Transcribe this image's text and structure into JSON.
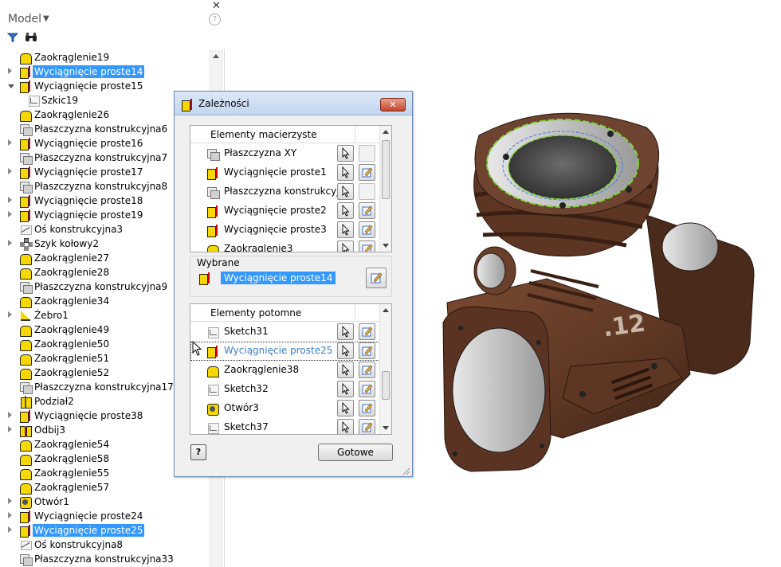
{
  "browser": {
    "title": "Model",
    "close": "✕",
    "help": "?",
    "tree": [
      {
        "label": "Zaokrąglenie19",
        "icon": "fillet",
        "expander": "none",
        "selected": false
      },
      {
        "label": "Wyciągnięcie proste14",
        "icon": "extrude",
        "expander": "closed",
        "selected": true
      },
      {
        "label": "Wyciągnięcie proste15",
        "icon": "extrude",
        "expander": "open",
        "selected": false
      },
      {
        "label": "Szkic19",
        "icon": "sketch",
        "expander": "none",
        "indent": true,
        "selected": false
      },
      {
        "label": "Zaokrąglenie26",
        "icon": "fillet",
        "expander": "none",
        "selected": false
      },
      {
        "label": "Płaszczyzna konstrukcyjna6",
        "icon": "plane",
        "expander": "none",
        "selected": false
      },
      {
        "label": "Wyciągnięcie proste16",
        "icon": "extrude",
        "expander": "closed",
        "selected": false
      },
      {
        "label": "Płaszczyzna konstrukcyjna7",
        "icon": "plane",
        "expander": "none",
        "selected": false
      },
      {
        "label": "Wyciągnięcie proste17",
        "icon": "extrude",
        "expander": "closed",
        "selected": false
      },
      {
        "label": "Płaszczyzna konstrukcyjna8",
        "icon": "plane",
        "expander": "none",
        "selected": false
      },
      {
        "label": "Wyciągnięcie proste18",
        "icon": "extrude",
        "expander": "closed",
        "selected": false
      },
      {
        "label": "Wyciągnięcie proste19",
        "icon": "extrude",
        "expander": "closed",
        "selected": false
      },
      {
        "label": "Oś konstrukcyjna3",
        "icon": "axis",
        "expander": "none",
        "selected": false
      },
      {
        "label": "Szyk kołowy2",
        "icon": "pattern",
        "expander": "closed",
        "selected": false
      },
      {
        "label": "Zaokrąglenie27",
        "icon": "fillet",
        "expander": "none",
        "selected": false
      },
      {
        "label": "Zaokrąglenie28",
        "icon": "fillet",
        "expander": "none",
        "selected": false
      },
      {
        "label": "Płaszczyzna konstrukcyjna9",
        "icon": "plane",
        "expander": "none",
        "selected": false
      },
      {
        "label": "Zaokrąglenie34",
        "icon": "fillet",
        "expander": "none",
        "selected": false
      },
      {
        "label": "Żebro1",
        "icon": "rib",
        "expander": "closed",
        "selected": false
      },
      {
        "label": "Zaokrąglenie49",
        "icon": "fillet",
        "expander": "none",
        "selected": false
      },
      {
        "label": "Zaokrąglenie50",
        "icon": "fillet",
        "expander": "none",
        "selected": false
      },
      {
        "label": "Zaokrąglenie51",
        "icon": "fillet",
        "expander": "none",
        "selected": false
      },
      {
        "label": "Zaokrąglenie52",
        "icon": "fillet",
        "expander": "none",
        "selected": false
      },
      {
        "label": "Płaszczyzna konstrukcyjna17",
        "icon": "plane",
        "expander": "none",
        "selected": false
      },
      {
        "label": "Podział2",
        "icon": "split",
        "expander": "none",
        "selected": false
      },
      {
        "label": "Wyciągnięcie proste38",
        "icon": "extrude",
        "expander": "closed",
        "selected": false
      },
      {
        "label": "Odbij3",
        "icon": "mirror",
        "expander": "closed",
        "selected": false
      },
      {
        "label": "Zaokrąglenie54",
        "icon": "fillet",
        "expander": "none",
        "selected": false
      },
      {
        "label": "Zaokrąglenie58",
        "icon": "fillet",
        "expander": "none",
        "selected": false
      },
      {
        "label": "Zaokrąglenie55",
        "icon": "fillet",
        "expander": "none",
        "selected": false
      },
      {
        "label": "Zaokrąglenie57",
        "icon": "fillet",
        "expander": "none",
        "selected": false
      },
      {
        "label": "Otwór1",
        "icon": "hole",
        "expander": "closed",
        "selected": false
      },
      {
        "label": "Wyciągnięcie proste24",
        "icon": "extrude",
        "expander": "closed",
        "selected": false
      },
      {
        "label": "Wyciągnięcie proste25",
        "icon": "extrude",
        "expander": "closed",
        "selected": true
      },
      {
        "label": "Oś konstrukcyjna8",
        "icon": "axis",
        "expander": "none",
        "selected": false
      },
      {
        "label": "Płaszczyzna konstrukcyjna33",
        "icon": "plane",
        "expander": "none",
        "selected": false
      }
    ]
  },
  "dialog": {
    "title": "Zależności",
    "close": "✕",
    "parents": {
      "header": "Elementy macierzyste",
      "items": [
        {
          "label": "Płaszczyzna XY",
          "icon": "plane",
          "edit": false
        },
        {
          "label": "Wyciągnięcie proste1",
          "icon": "extrude",
          "edit": true
        },
        {
          "label": "Płaszczyzna konstrukcyjna",
          "icon": "plane",
          "edit": false
        },
        {
          "label": "Wyciągnięcie proste2",
          "icon": "extrude",
          "edit": true
        },
        {
          "label": "Wyciągnięcie proste3",
          "icon": "extrude",
          "edit": true
        },
        {
          "label": "Zaokrąglenie3",
          "icon": "fillet",
          "edit": true
        }
      ]
    },
    "selected": {
      "label": "Wybrane",
      "value": "Wyciągnięcie proste14"
    },
    "children": {
      "header": "Elementy potomne",
      "items": [
        {
          "label": "Sketch31",
          "icon": "sketch",
          "highlight": false
        },
        {
          "label": "Wyciągnięcie proste25",
          "icon": "extrude",
          "highlight": true
        },
        {
          "label": "Zaokrąglenie38",
          "icon": "fillet",
          "highlight": false
        },
        {
          "label": "Sketch32",
          "icon": "sketch",
          "highlight": false
        },
        {
          "label": "Otwór3",
          "icon": "hole",
          "highlight": false
        },
        {
          "label": "Sketch37",
          "icon": "sketch",
          "highlight": false
        }
      ]
    },
    "help": "?",
    "ok": "Gotowe"
  },
  "model": {
    "engraving": ".12",
    "body_color": "#6b3f2a",
    "face_color": "#9e9e9e",
    "highlight_color": "#7fd63b"
  }
}
